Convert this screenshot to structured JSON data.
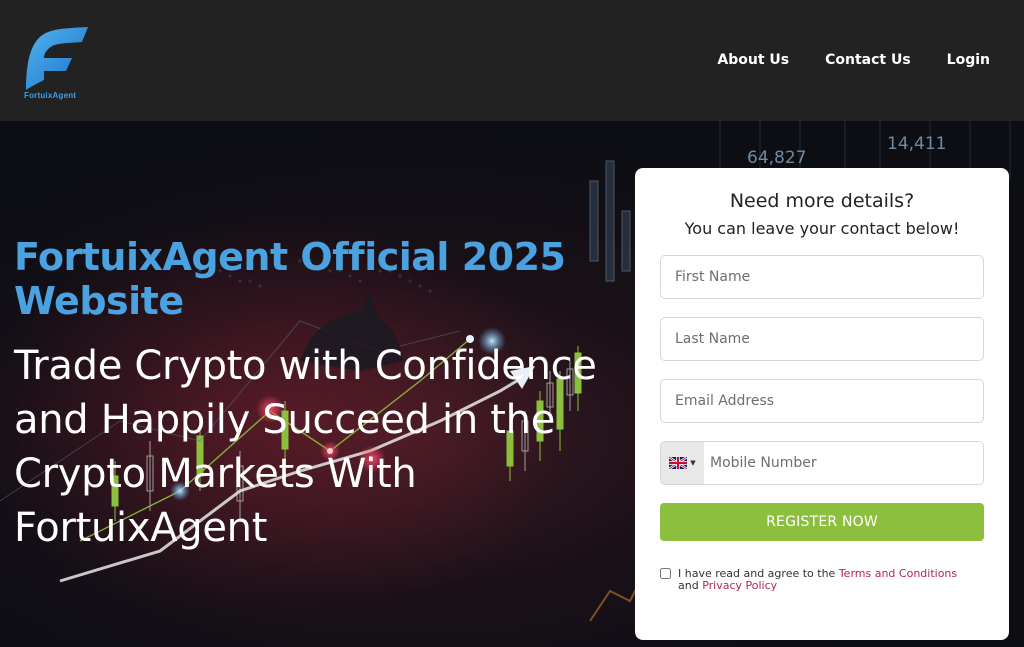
{
  "brand": {
    "name": "FortuixAgent"
  },
  "nav": {
    "items": [
      {
        "label": "About Us"
      },
      {
        "label": "Contact Us"
      },
      {
        "label": "Login"
      }
    ]
  },
  "hero": {
    "title": "FortuixAgent Official 2025 Website",
    "subtitle": "Trade Crypto with Confidence and Happily Succeed in the Crypto Markets With FortuixAgent",
    "bg_numbers": [
      "64,827",
      "14,411"
    ]
  },
  "form": {
    "title": "Need more details?",
    "subtitle": "You can leave your contact below!",
    "first_name_placeholder": "First Name",
    "last_name_placeholder": "Last Name",
    "email_placeholder": "Email Address",
    "phone_placeholder": "Mobile Number",
    "country_flag": "uk-flag-icon",
    "register_label": "REGISTER NOW",
    "agree_prefix": "I have read and agree to the",
    "terms_label": "Terms and Conditions",
    "and_label": "and",
    "privacy_label": "Privacy Policy"
  },
  "colors": {
    "header_bg": "#222222",
    "brand_blue": "#4aa3e0",
    "register_green": "#8dbf3f",
    "link_pink": "#b5245a"
  }
}
